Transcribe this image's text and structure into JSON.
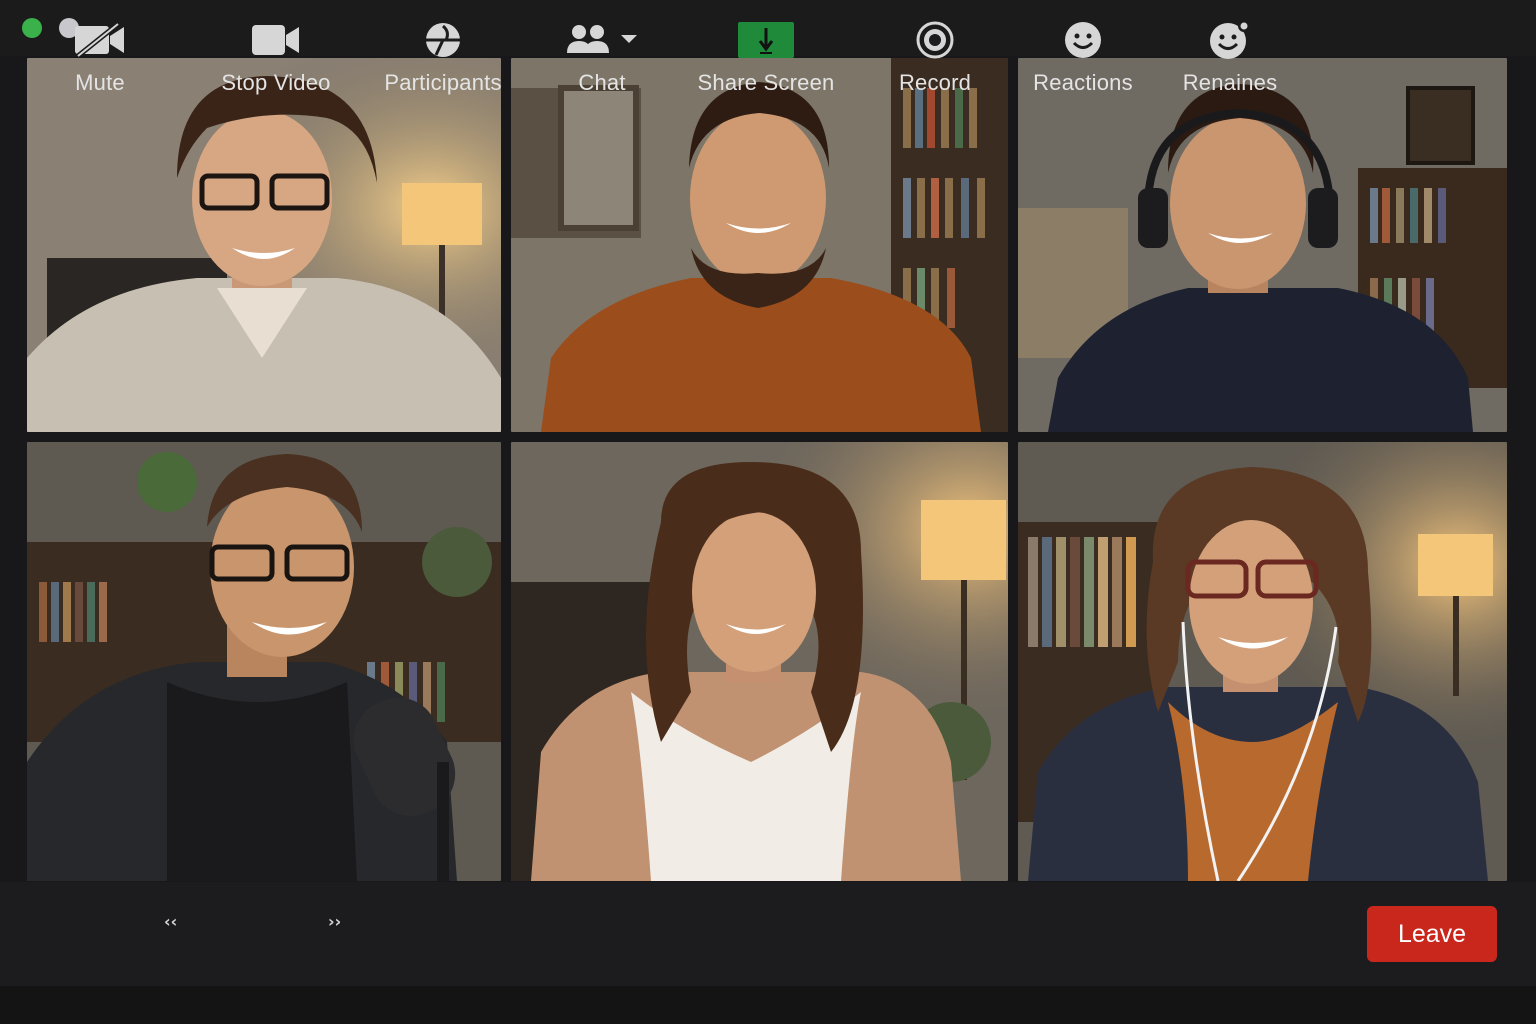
{
  "window": {
    "controls": [
      {
        "icon": "window-dot-green-icon",
        "color": "#3ab14a"
      },
      {
        "icon": "window-dot-grey-icon",
        "color": "#c8c8cc"
      }
    ]
  },
  "participants": [
    {
      "id": "p1",
      "shirt": "light-button-shirt"
    },
    {
      "id": "p2",
      "shirt": "rust-tshirt"
    },
    {
      "id": "p3",
      "shirt": "navy-tshirt-headphones"
    },
    {
      "id": "p4",
      "shirt": "dark-hoodie-microphone"
    },
    {
      "id": "p5",
      "shirt": "white-tank-top"
    },
    {
      "id": "p6",
      "shirt": "navy-hoodie-earbuds"
    }
  ],
  "toolbar": {
    "mute_label": "Mute",
    "stop_video_label": "Stop Video",
    "participants_label": "Participants",
    "chat_label": "Chat",
    "share_screen_label": "Share Screen",
    "record_label": "Record",
    "reactions_label": "Reactions",
    "renaines_label": "Renaines",
    "leave_label": "Leave",
    "caret_left": "‹‹",
    "caret_right": "››",
    "share_color": "#1f8a3a",
    "leave_color": "#c9261c"
  }
}
